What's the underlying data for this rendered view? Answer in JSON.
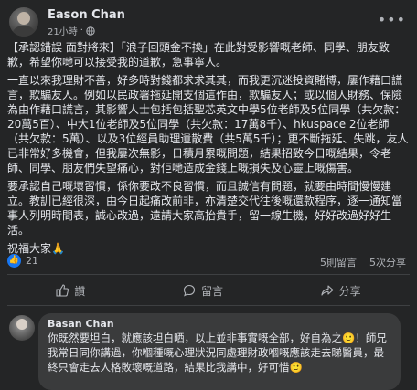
{
  "post": {
    "author": "Eason Chan",
    "time": "21小時",
    "paragraphs": [
      "【承認錯誤 面對將來】「浪子回頭金不換」在此對受影響嘅老師、同學、朋友致歉，希望你哋可以接受我的道歉，急事寧人。",
      "一直以來我理財不善，好多時對錢都求求其其，而我更沉迷投資賭博，屢作藉口謊言，欺騙友人。例如以民政署拖延開支個這作由，欺騙友人；或以個人財務、保險為由作藉口謊言，其影響人士包括包括聖芯英文中學5位老師及5位同學（共欠款：20萬5百）、中大1位老師及5位同學（共欠款：17萬8千）、hkuspace 2位老師（共欠款：5萬）、以及3位經員助理遺散費（共5萬5千）；更不斷拖延、失跳，友人已非常好多機會，但我屢次無影，日積月累嘅問題，結果招致今日嘅結果，令老師、同學、朋友們失望痛心，對佢哋造成金錢上嘅損失及心靈上嘅傷害。",
      "要承認自己嘅壞習慣，係你要改不良習慣，而且誠信有問題，就要由時間慢慢建立。教訓已經很深，由今日起痛改前非，亦清楚交代往後嘅還款程序，逐一通知當事人列明時間表，誠心改過，遠請大家高抬貴手，留一線生機，好好改過好好生活。",
      "祝福大家🙏"
    ]
  },
  "stats": {
    "reactions": "21",
    "comments": "5則留言",
    "shares": "5次分享"
  },
  "actions": {
    "like": "讚",
    "comment": "留言",
    "share": "分享"
  },
  "comment": {
    "author": "Basan Chan",
    "text": "你既然要坦白，就應該坦白晒，以上並非事實嘅全部，好自為之🙂！師兄我常日同你講過，你嗰種嘅心理狀況同處理財政嗰嘅應該走去睇醫員，最終只會走去人格敗壞嘅道路，結果比我講中，好可惜🙂"
  },
  "colors": {
    "background": "#242526",
    "text": "#e4e6eb",
    "muted": "#b0b3b8",
    "like_blue": "#1877f2",
    "bubble": "#3a3b3c"
  }
}
